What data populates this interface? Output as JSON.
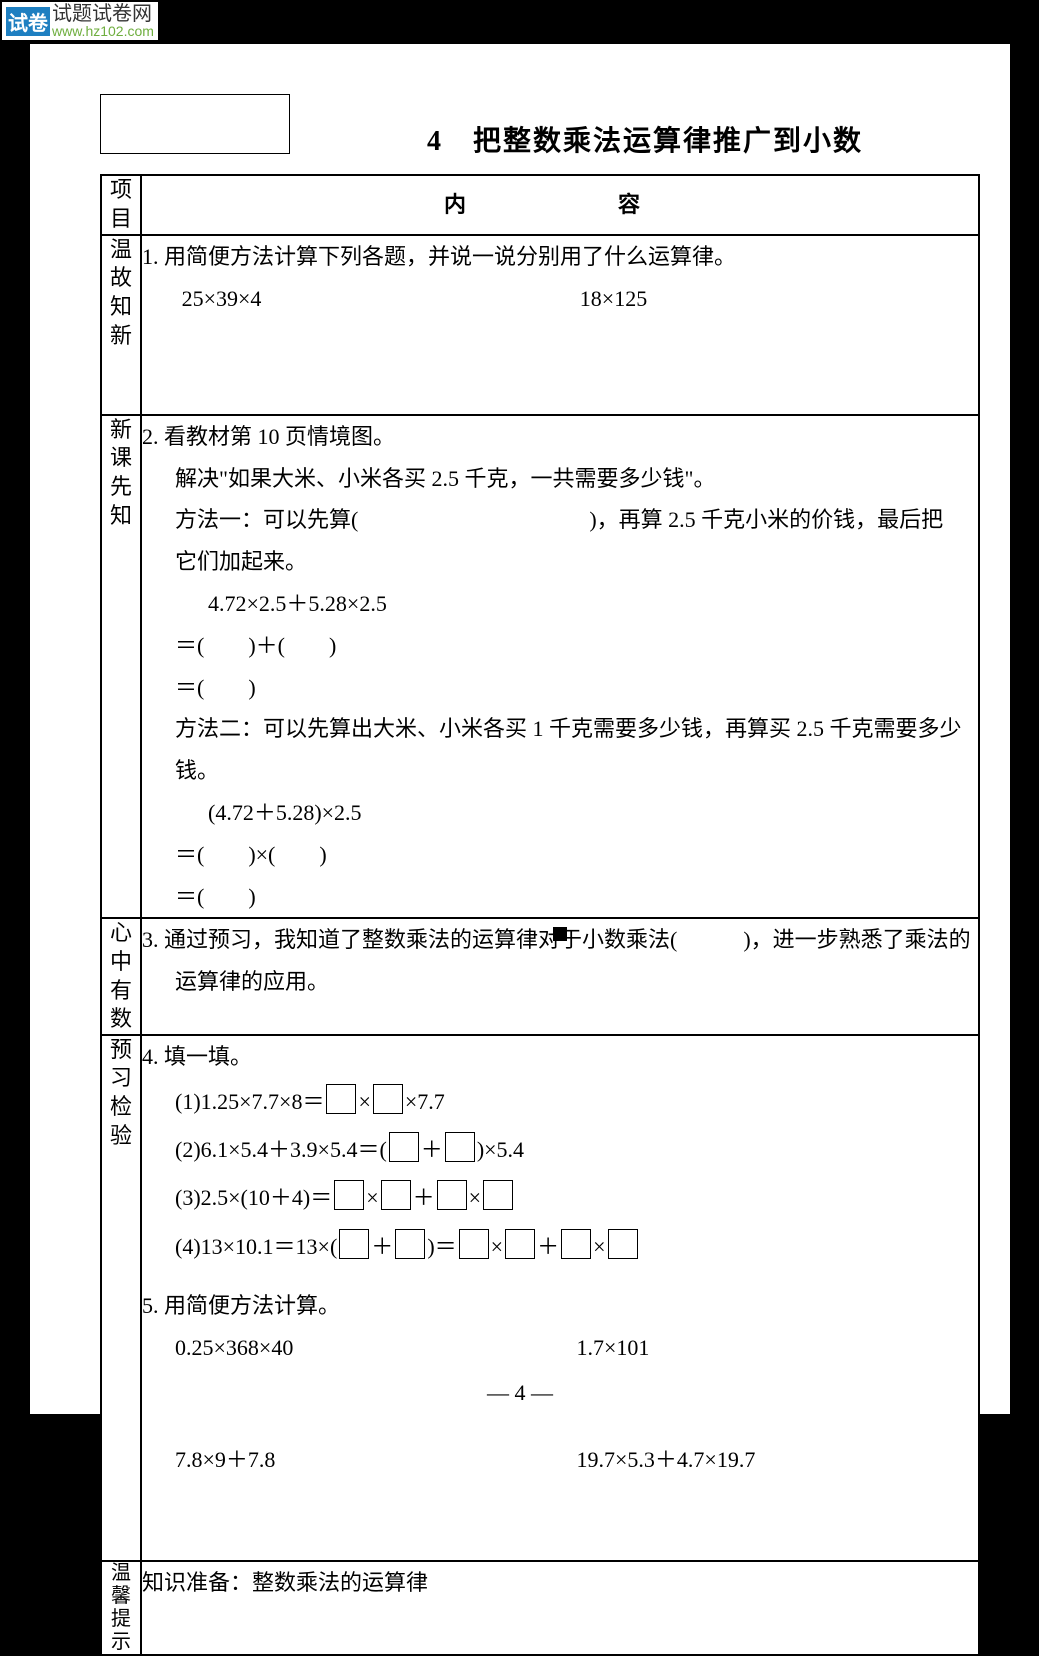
{
  "watermark": {
    "box": "试卷",
    "line1": "试题试卷网",
    "line2": "www.hz102.com"
  },
  "title_num": "4",
  "title_text": "把整数乘法运算律推广到小数",
  "header": {
    "col1": "项目",
    "col2": "内　　容"
  },
  "row_wgzx": {
    "label": "温故知新",
    "q1_lead": "1. 用简便方法计算下列各题，并说一说分别用了什么运算律。",
    "q1_a": "25×39×4",
    "q1_b": "18×125"
  },
  "row_xkxz": {
    "label": "新课先知",
    "l1": "2. 看教材第 10 页情境图。",
    "l2": "解决\"如果大米、小米各买 2.5 千克，一共需要多少钱\"。",
    "l3a": "方法一：可以先算(",
    "l3b": ")，再算 2.5 千克小米的价钱，最后把",
    "l4": "它们加起来。",
    "l5": "4.72×2.5＋5.28×2.5",
    "l6": "＝(　　)＋(　　)",
    "l7": "＝(　　)",
    "l8": "方法二：可以先算出大米、小米各买 1 千克需要多少钱，再算买 2.5 千克需要多少钱。",
    "l9": "(4.72＋5.28)×2.5",
    "l10": "＝(　　)×(　　)",
    "l11": "＝(　　)"
  },
  "row_xzys": {
    "label": "心中有数",
    "text_a": "3. 通过预习，我知道了整数乘法的运算律对于小数乘法(　　　)，进一步熟悉了乘法的",
    "text_b": "运算律的应用。"
  },
  "row_yxjy": {
    "label": "预习检验",
    "l1": "4. 填一填。",
    "e1_a": "(1)1.25×7.7×8＝",
    "e1_b": "×",
    "e1_c": "×7.7",
    "e2_a": "(2)6.1×5.4＋3.9×5.4＝(",
    "e2_b": "＋",
    "e2_c": ")×5.4",
    "e3_a": "(3)2.5×(10＋4)＝",
    "e3_b": "×",
    "e3_c": "＋",
    "e3_d": "×",
    "e4_a": "(4)13×10.1＝13×(",
    "e4_b": "＋",
    "e4_c": ")＝",
    "e4_d": "×",
    "e4_e": "＋",
    "e4_f": "×",
    "l5": "5. 用简便方法计算。",
    "p1": "0.25×368×40",
    "p2": "1.7×101",
    "p3": "7.8×9＋7.8",
    "p4": "19.7×5.3＋4.7×19.7"
  },
  "row_wxts": {
    "label": "温馨提示",
    "text": "知识准备：整数乘法的运算律"
  },
  "page_number": "— 4 —",
  "chart_data": null
}
